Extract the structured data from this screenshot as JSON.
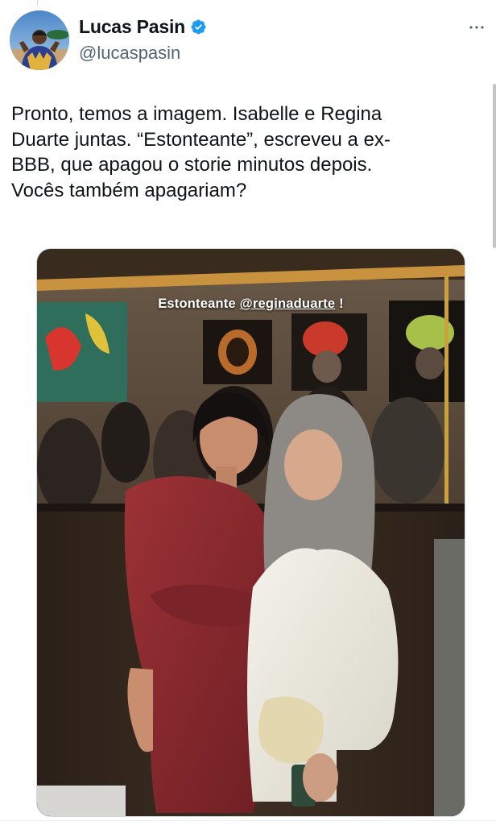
{
  "tweet": {
    "author": {
      "display_name": "Lucas Pasin",
      "handle": "@lucaspasin",
      "verified": true,
      "avatar_icon": "avatar"
    },
    "text": "Pronto, temos a imagem. Isabelle e Regina\nDuarte juntas. “Estonteante”, escreveu a ex-\nBBB, que apagou o storie minutos depois.\nVocês também apagariam?",
    "media": {
      "caption_word": "Estonteante",
      "caption_mention": "@reginaduarte",
      "caption_end": "!"
    }
  },
  "colors": {
    "verified_badge": "#1d9bf0",
    "handle_text": "#536471",
    "dress": "#8a2a2e",
    "blouse": "#ecebe2"
  },
  "icons": {
    "more": "more-horizontal-icon",
    "verified": "verified-badge-icon"
  }
}
